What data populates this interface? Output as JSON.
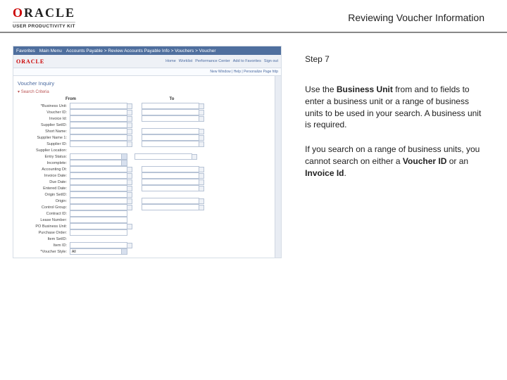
{
  "header": {
    "brand_main": "ORACLE",
    "brand_sub": "USER PRODUCTIVITY KIT",
    "page_title": "Reviewing Voucher Information"
  },
  "instructions": {
    "step": "Step 7",
    "p1_a": "Use the ",
    "p1_b": "Business Unit",
    "p1_c": " from and to fields to enter a business unit or a range of business units to be used in your search. A business unit is required.",
    "p2_a": "If you search on a range of business units, you cannot search on either a ",
    "p2_b": "Voucher ID",
    "p2_c": " or an ",
    "p2_d": "Invoice Id",
    "p2_e": "."
  },
  "mini": {
    "topnav": {
      "favorites": "Favorites",
      "main": "Main Menu",
      "path": "Accounts Payable  >  Review Accounts Payable Info  >  Vouchers  >  Voucher"
    },
    "brand": "ORACLE",
    "sublinks": {
      "home": "Home",
      "worklist": "Worklist",
      "perf": "Performance Center",
      "add_fav": "Add to Favorites",
      "signout": "Sign out"
    },
    "toolbar": {
      "new": "New Window",
      "help": "Help",
      "personalize": "Personalize Page",
      "http": "http"
    },
    "form_title": "Voucher Inquiry",
    "search_criteria": "Search Criteria",
    "cols": {
      "from": "From",
      "to": "To"
    },
    "rows": [
      {
        "label": "*Business Unit:",
        "type": "from-to-lookup"
      },
      {
        "label": "Voucher ID:",
        "type": "from-to-lookup"
      },
      {
        "label": "Invoice Id:",
        "type": "from-to-lookup"
      },
      {
        "label": "Supplier SetID:",
        "type": "single-lookup"
      },
      {
        "label": "Short Name:",
        "type": "from-to-lookup"
      },
      {
        "label": "Supplier Name 1:",
        "type": "from-to-lookup"
      },
      {
        "label": "Supplier ID:",
        "type": "from-to-lookup"
      },
      {
        "label": "Supplier Location:",
        "type": "blank"
      },
      {
        "label": "Entry Status:",
        "type": "select-from"
      },
      {
        "label": "Incomplete:",
        "type": "select-blank"
      },
      {
        "label": "Accounting Dt:",
        "type": "from-to-lookup"
      },
      {
        "label": "Invoice Date:",
        "type": "from-to-lookup"
      },
      {
        "label": "Due Date:",
        "type": "from-to-lookup"
      },
      {
        "label": "Entered Date:",
        "type": "from-to-lookup"
      },
      {
        "label": "Origin SetID:",
        "type": "single-lookup"
      },
      {
        "label": "Origin:",
        "type": "from-to-lookup"
      },
      {
        "label": "Control Group:",
        "type": "from-to-lookup"
      },
      {
        "label": "Contract ID:",
        "type": "single-nolookup"
      },
      {
        "label": "Lease Number:",
        "type": "single-nolookup"
      },
      {
        "label": "PO Business Unit:",
        "type": "single-lookup"
      },
      {
        "label": "Purchase Order:",
        "type": "single-nolookup"
      },
      {
        "label": "Item SetID:",
        "type": "blank"
      },
      {
        "label": "Item ID:",
        "type": "single-lookup"
      }
    ],
    "voucher_style": {
      "label": "*Voucher Style:",
      "value": "All"
    }
  }
}
